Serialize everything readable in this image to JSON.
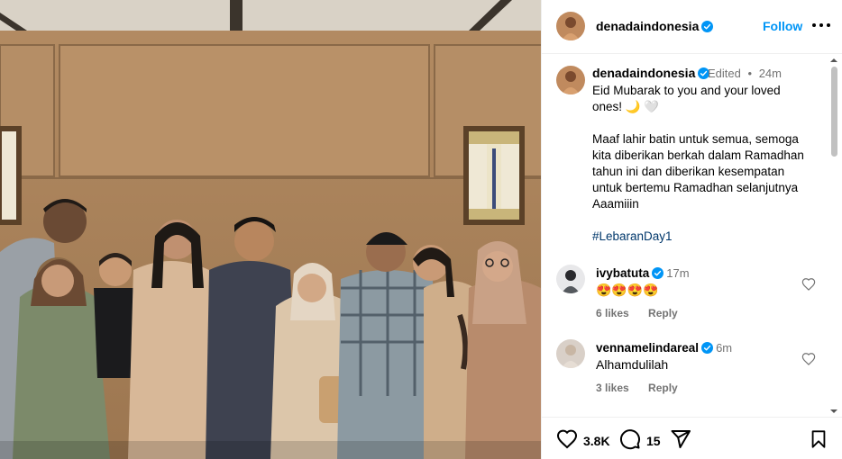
{
  "post": {
    "username": "denadaindonesia",
    "follow_label": "Follow",
    "caption": {
      "edited_label": "Edited",
      "separator": "•",
      "time": "24m",
      "lines": [
        "Eid Mubarak to you and your loved",
        "ones! 🌙 🤍"
      ],
      "paragraph2": [
        "Maaf lahir batin untuk semua, semoga",
        "kita diberikan berkah dalam Ramadhan",
        "tahun ini dan diberikan kesempatan",
        "untuk bertemu Ramadhan selanjutnya",
        "Aaamiiin"
      ],
      "hashtag": "#LebaranDay1"
    }
  },
  "comments": [
    {
      "username": "ivybatuta",
      "time": "17m",
      "text": "😍😍😍😍",
      "likes": "6 likes",
      "reply": "Reply"
    },
    {
      "username": "vennamelindareal",
      "time": "6m",
      "text": "Alhamdulilah",
      "likes": "3 likes",
      "reply": "Reply"
    }
  ],
  "actions": {
    "likes_count": "3.8K",
    "comments_count": "15"
  },
  "icons": {
    "verified": "verified-badge-icon",
    "more": "more-options-icon",
    "like": "heart-icon",
    "comment": "comment-icon",
    "share": "share-icon",
    "save": "bookmark-icon"
  },
  "colors": {
    "link_blue": "#0095f6",
    "hashtag": "#00376b",
    "muted": "#737373"
  }
}
